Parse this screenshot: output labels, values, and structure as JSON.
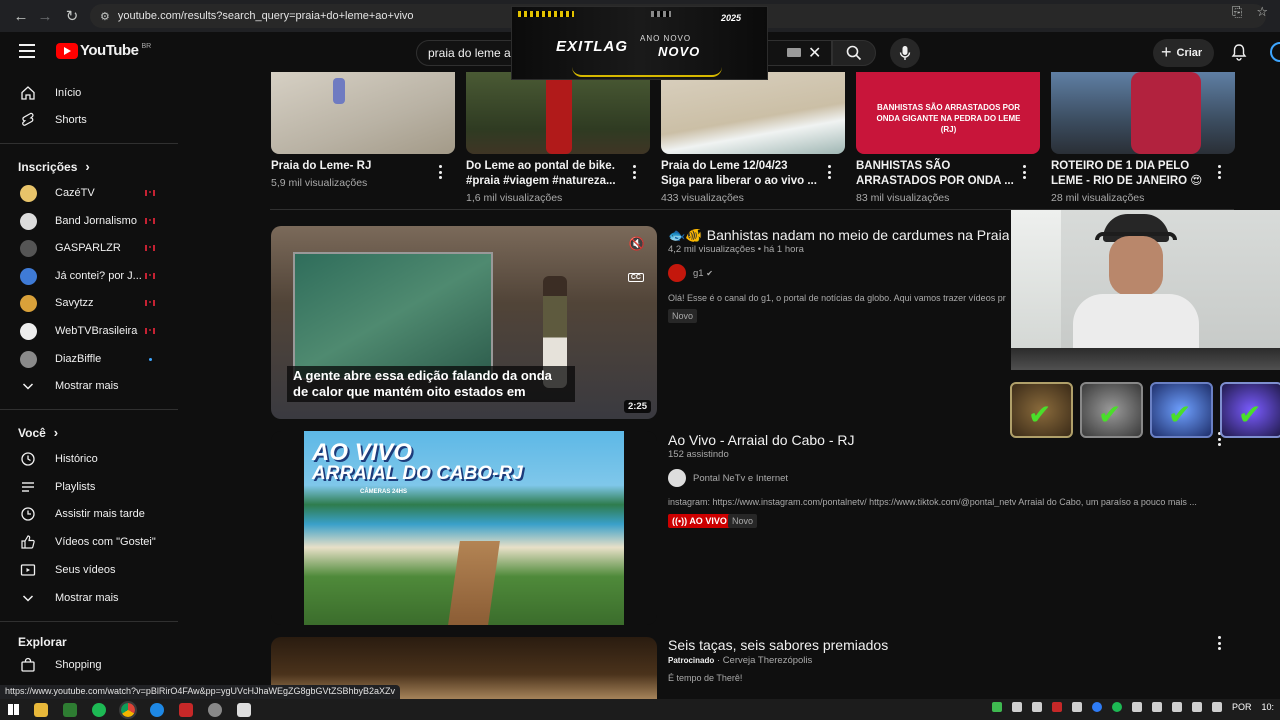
{
  "browser": {
    "url": "youtube.com/results?search_query=praia+do+leme+ao+vivo",
    "status_url": "https://www.youtube.com/watch?v=pBlRirO4FAw&pp=ygUVcHJhaWEgZG8gbGVtZSBhbyB2aXZv"
  },
  "ad_overlay": {
    "brand": "EXITLAG",
    "line1": "ANO NOVO",
    "line2": "NOVO",
    "year": "2025"
  },
  "header": {
    "logo": "YouTube",
    "region": "BR",
    "search_value": "praia do leme a",
    "create_label": "Criar"
  },
  "sidebar": {
    "top": [
      {
        "label": "Início",
        "icon": "home-icon"
      },
      {
        "label": "Shorts",
        "icon": "shorts-icon"
      }
    ],
    "subs_heading": "Inscrições",
    "subs": [
      {
        "label": "CazéTV",
        "color": "#e8c46a",
        "status": "live"
      },
      {
        "label": "Band Jornalismo",
        "color": "#dcdcdc",
        "status": "live"
      },
      {
        "label": "GASPARLZR",
        "color": "#555555",
        "status": "live"
      },
      {
        "label": "Já contei? por J...",
        "color": "#3f7bd6",
        "status": "live"
      },
      {
        "label": "Savytzz",
        "color": "#d9a13a",
        "status": "live"
      },
      {
        "label": "WebTVBrasileira",
        "color": "#eeeeee",
        "status": "live"
      },
      {
        "label": "DiazBiffle",
        "color": "#8a8a8a",
        "status": "new"
      }
    ],
    "show_more": "Mostrar mais",
    "you_heading": "Você",
    "you": [
      {
        "label": "Histórico",
        "icon": "history-icon"
      },
      {
        "label": "Playlists",
        "icon": "playlists-icon"
      },
      {
        "label": "Assistir mais tarde",
        "icon": "watch-later-icon"
      },
      {
        "label": "Vídeos com \"Gostei\"",
        "icon": "like-icon"
      },
      {
        "label": "Seus vídeos",
        "icon": "your-videos-icon"
      },
      {
        "label": "Mostrar mais",
        "icon": "chevron-down-icon"
      }
    ],
    "explore_heading": "Explorar",
    "explore": [
      {
        "label": "Shopping",
        "icon": "shopping-icon"
      }
    ]
  },
  "shelf": [
    {
      "title1": "Praia do Leme- RJ",
      "title2": "",
      "meta": "5,9 mil visualizações"
    },
    {
      "title1": "Do Leme ao pontal de bike.",
      "title2": "#praia #viagem #natureza...",
      "meta": "1,6 mil visualizações"
    },
    {
      "title1": "Praia do Leme 12/04/23",
      "title2": "Siga para liberar o ao vivo ...",
      "meta": "433 visualizações"
    },
    {
      "title1": "BANHISTAS SÃO",
      "title2": "ARRASTADOS POR ONDA ...",
      "meta": "83 mil visualizações",
      "thumb_text": "BANHISTAS SÃO ARRASTADOS POR ONDA GIGANTE NA PEDRA DO LEME (RJ)"
    },
    {
      "title1": "ROTEIRO DE 1 DIA PELO",
      "title2": "LEME - RIO DE JANEIRO 😍",
      "meta": "28 mil visualizações"
    }
  ],
  "results": [
    {
      "title": "🐟🐠 Banhistas nadam no meio de cardumes na Praia",
      "meta": "4,2 mil visualizações • há 1 hora",
      "channel": "g1",
      "desc": "Olá! Esse é o canal do g1, o portal de notícias da globo. Aqui vamos trazer vídeos pr",
      "badge": "Novo",
      "duration": "2:25",
      "caption": "A gente abre essa edição falando da onda de calor que mantém oito estados em",
      "cc": "CC"
    },
    {
      "title": "Ao Vivo - Arraial do Cabo - RJ",
      "meta": "152 assistindo",
      "channel": "Pontal NeTv e Internet",
      "desc": "instagram: https://www.instagram.com/pontalnetv/ https://www.tiktok.com/@pontal_netv Arraial do Cabo, um paraíso a pouco mais ...",
      "live_badge": "AO VIVO",
      "badge": "Novo",
      "thumb_line1": "AO VIVO",
      "thumb_line2": "ARRAIAL DO CABO-RJ",
      "thumb_line3": "CÂMERAS 24HS"
    },
    {
      "title": "Seis taças, seis sabores premiados",
      "sponsored": "Patrocinado",
      "channel": "Cerveja Therezópolis",
      "desc": "É tempo de Therê!"
    }
  ],
  "taskbar": {
    "lang": "POR",
    "time": "10:"
  }
}
